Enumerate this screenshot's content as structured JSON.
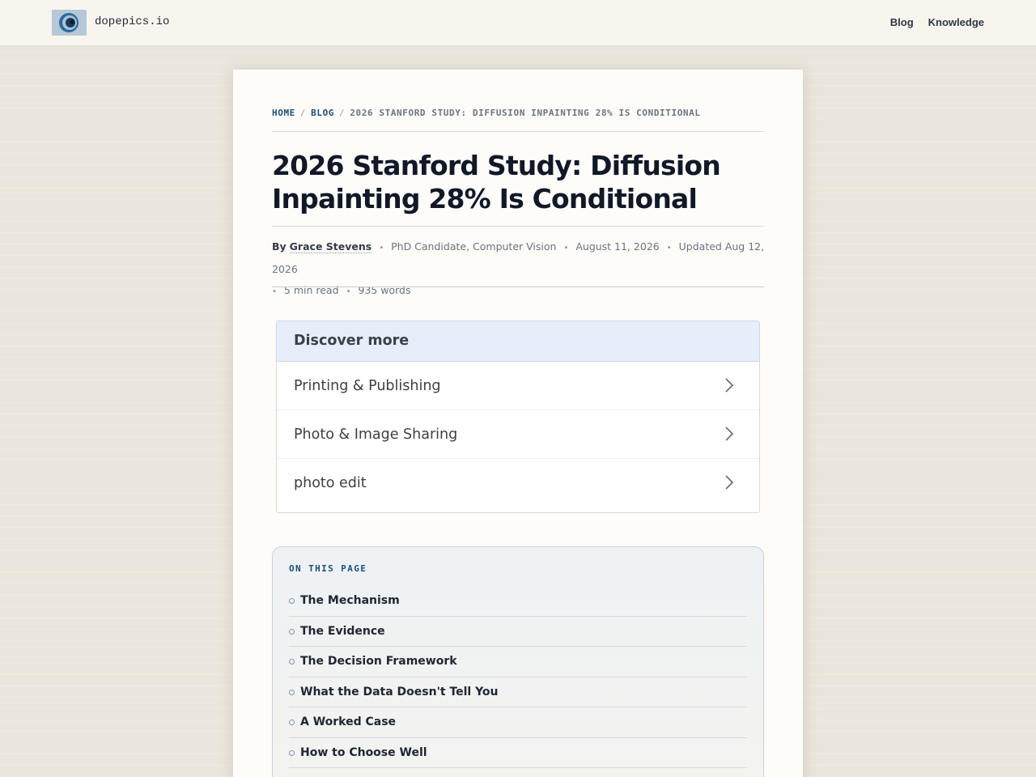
{
  "header": {
    "brand": "dopepics.io",
    "nav": [
      {
        "label": "Blog"
      },
      {
        "label": "Knowledge"
      }
    ]
  },
  "breadcrumb": {
    "home": "HOME",
    "blog": "BLOG",
    "sep": "/",
    "current": "2026 STANFORD STUDY: DIFFUSION INPAINTING 28% IS CONDITIONAL"
  },
  "article": {
    "title": "2026 Stanford Study: Diffusion Inpainting 28% Is Conditional",
    "by": "By",
    "author": "Grace Stevens",
    "role": "PhD Candidate, Computer Vision",
    "date": "August 11, 2026",
    "updated": "Updated Aug 12, 2026",
    "read_time": "5 min read",
    "words": "935 words",
    "dot": "•"
  },
  "discover": {
    "heading": "Discover more",
    "items": [
      {
        "label": "Printing & Publishing"
      },
      {
        "label": "Photo & Image Sharing"
      },
      {
        "label": "photo edit"
      }
    ]
  },
  "toc": {
    "label": "ON THIS PAGE",
    "items": [
      {
        "label": "The Mechanism"
      },
      {
        "label": "The Evidence"
      },
      {
        "label": "The Decision Framework"
      },
      {
        "label": "What the Data Doesn't Tell You"
      },
      {
        "label": "A Worked Case"
      },
      {
        "label": "How to Choose Well"
      }
    ]
  },
  "colors": {
    "accent": "#1d4f78",
    "title": "#111827",
    "discover_header_bg": "#e6eefc"
  },
  "icons": [
    "site-logo-icon",
    "chevron-right-icon",
    "toc-bullet-icon"
  ]
}
